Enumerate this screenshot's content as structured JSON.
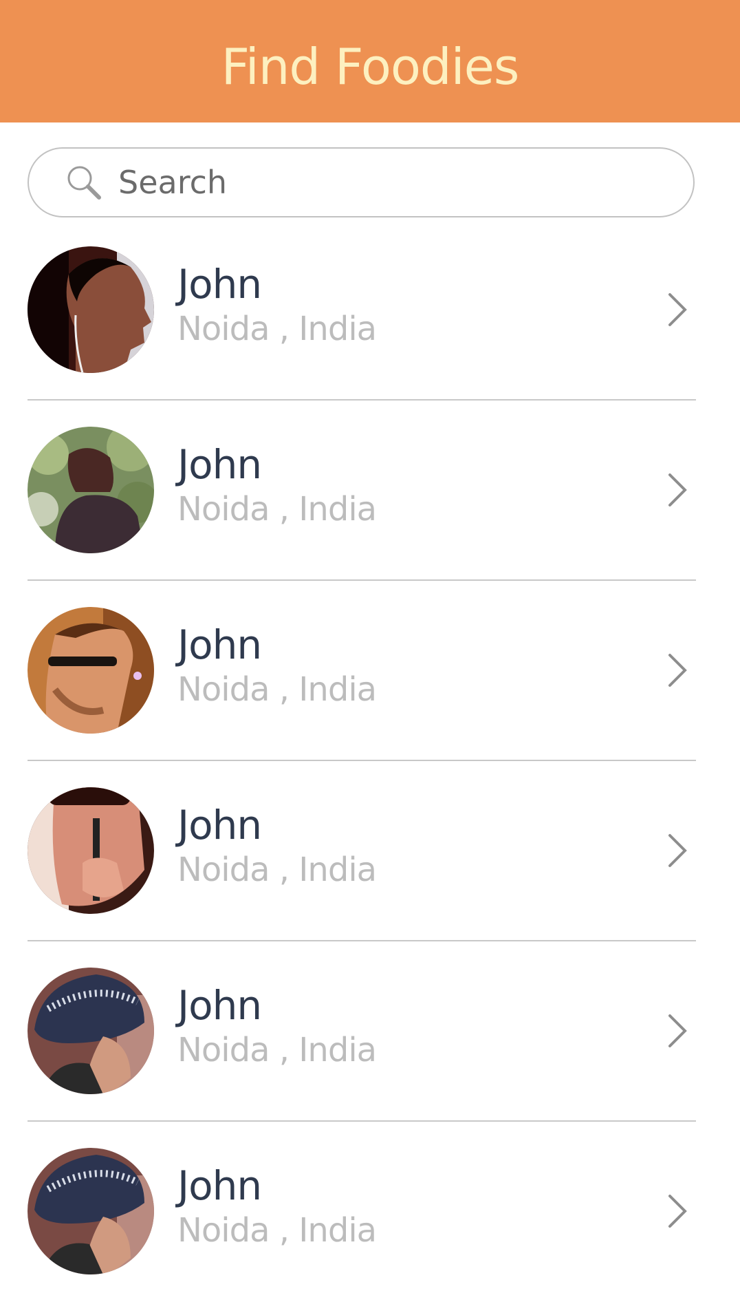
{
  "header": {
    "title": "Find Foodies",
    "background": "#ee9152",
    "title_color": "#fdf0c0"
  },
  "search": {
    "placeholder": "Search",
    "icon": "search-icon"
  },
  "foodies": [
    {
      "name": "John",
      "location": "Noida , India",
      "avatar": "avatar-man-headphones"
    },
    {
      "name": "John",
      "location": "Noida , India",
      "avatar": "avatar-woman-back"
    },
    {
      "name": "John",
      "location": "Noida , India",
      "avatar": "avatar-man-sunglasses"
    },
    {
      "name": "John",
      "location": "Noida , India",
      "avatar": "avatar-woman-straw"
    },
    {
      "name": "John",
      "location": "Noida , India",
      "avatar": "avatar-woman-hat"
    },
    {
      "name": "John",
      "location": "Noida , India",
      "avatar": "avatar-woman-hat"
    }
  ],
  "row_icon": "chevron-right-icon"
}
